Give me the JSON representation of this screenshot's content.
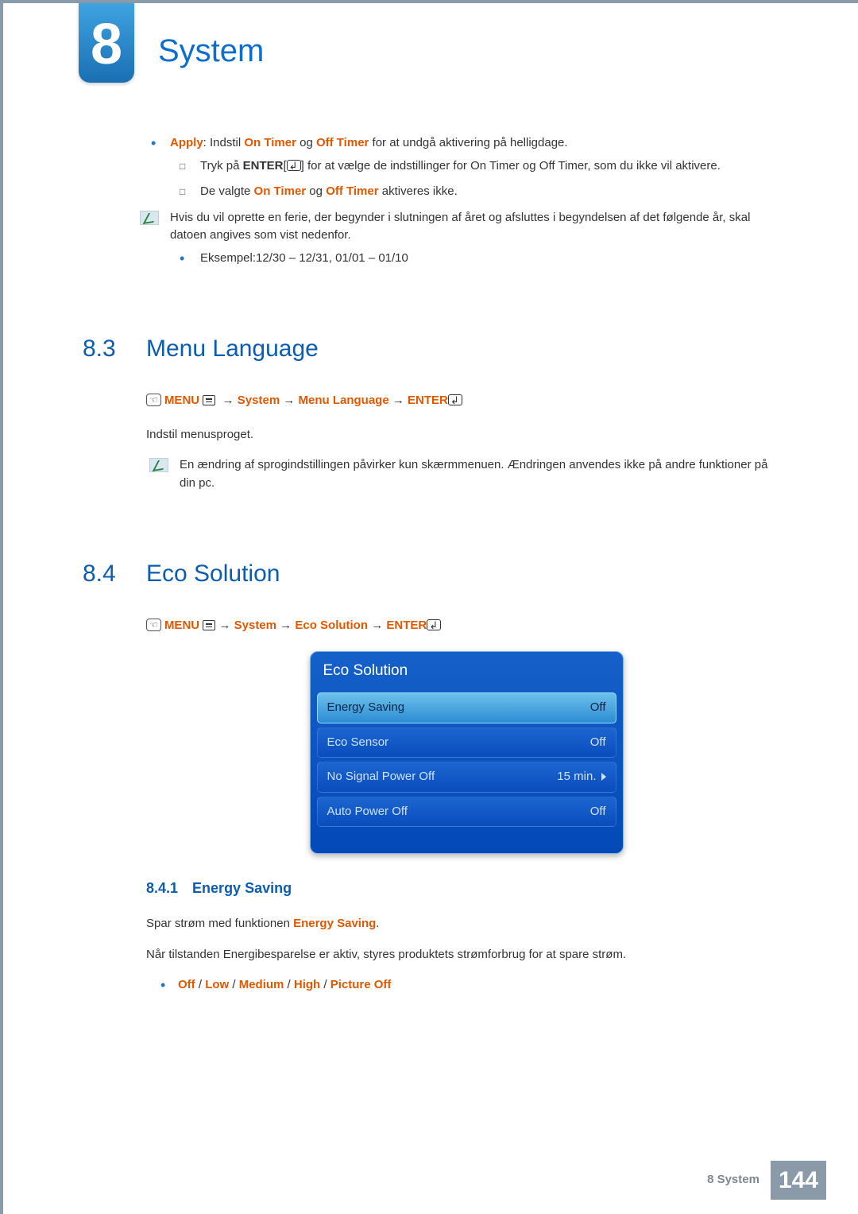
{
  "chapter": {
    "number": "8",
    "title": "System"
  },
  "apply": {
    "label": "Apply",
    "timer_on": "On Timer",
    "timer_off": "Off Timer",
    "text_after": ": Indstil ",
    "text_mid": " og ",
    "text_end": " for at undgå aktivering på helligdage."
  },
  "enter": {
    "prefix": "Tryk på ",
    "enter_label": "ENTER",
    "suffix": "] for at vælge de indstillinger for On Timer og Off Timer, som du ikke vil aktivere."
  },
  "deactivate": {
    "pre": "De valgte ",
    "t1": "On Timer",
    "mid": " og ",
    "t2": "Off Timer",
    "post": " aktiveres ikke."
  },
  "holiday_note": "Hvis du vil oprette en ferie, der begynder i slutningen af året og afsluttes i begyndelsen af det følgende år, skal datoen angives som vist nedenfor.",
  "example": "Eksempel:12/30 – 12/31, 01/01 – 01/10",
  "s83": {
    "num": "8.3",
    "title": "Menu Language",
    "path": {
      "menu": "MENU",
      "sys": "System",
      "item": "Menu Language",
      "enter": "ENTER"
    },
    "body": "Indstil menusproget.",
    "note": "En ændring af sprogindstillingen påvirker kun skærmmenuen. Ændringen anvendes ikke på andre funktioner på din pc."
  },
  "s84": {
    "num": "8.4",
    "title": "Eco Solution",
    "path": {
      "menu": "MENU",
      "sys": "System",
      "item": "Eco Solution",
      "enter": "ENTER"
    },
    "osd": {
      "title": "Eco Solution",
      "rows": [
        {
          "label": "Energy Saving",
          "value": "Off",
          "selected": true
        },
        {
          "label": "Eco Sensor",
          "value": "Off",
          "selected": false
        },
        {
          "label": "No Signal Power Off",
          "value": "15 min.",
          "selected": false,
          "chevron": true
        },
        {
          "label": "Auto Power Off",
          "value": "Off",
          "selected": false
        }
      ]
    },
    "sub": {
      "num": "8.4.1",
      "title": "Energy Saving",
      "line1_pre": "Spar strøm med funktionen ",
      "line1_hl": "Energy Saving",
      "line1_post": ".",
      "line2": "Når tilstanden Energibesparelse er aktiv, styres produktets strømforbrug for at spare strøm.",
      "opts": [
        "Off",
        "Low",
        "Medium",
        "High",
        "Picture Off"
      ],
      "sep": " / "
    }
  },
  "footer": {
    "text": "8 System",
    "page": "144"
  }
}
